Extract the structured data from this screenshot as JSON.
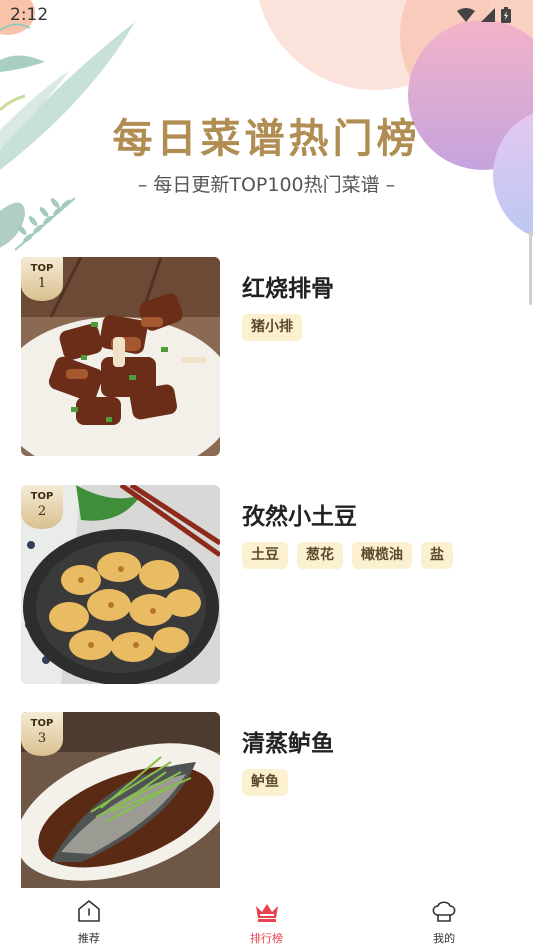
{
  "status_bar": {
    "time": "2:12"
  },
  "header": {
    "title": "每日菜谱热门榜",
    "subtitle": "– 每日更新TOP100热门菜谱 –"
  },
  "recipes": [
    {
      "rank_label": "TOP",
      "rank": "1",
      "name": "红烧排骨",
      "tags": [
        "猪小排"
      ]
    },
    {
      "rank_label": "TOP",
      "rank": "2",
      "name": "孜然小土豆",
      "tags": [
        "土豆",
        "葱花",
        "橄榄油",
        "盐"
      ]
    },
    {
      "rank_label": "TOP",
      "rank": "3",
      "name": "清蒸鲈鱼",
      "tags": [
        "鲈鱼"
      ]
    }
  ],
  "bottom_nav": [
    {
      "label": "推荐",
      "icon": "home-icon",
      "active": false
    },
    {
      "label": "排行榜",
      "icon": "crown-icon",
      "active": true
    },
    {
      "label": "我的",
      "icon": "chef-hat-icon",
      "active": false
    }
  ],
  "colors": {
    "accent": "#e8434f",
    "title_gold": "#b08d52",
    "tag_bg": "#fbf0cf"
  }
}
